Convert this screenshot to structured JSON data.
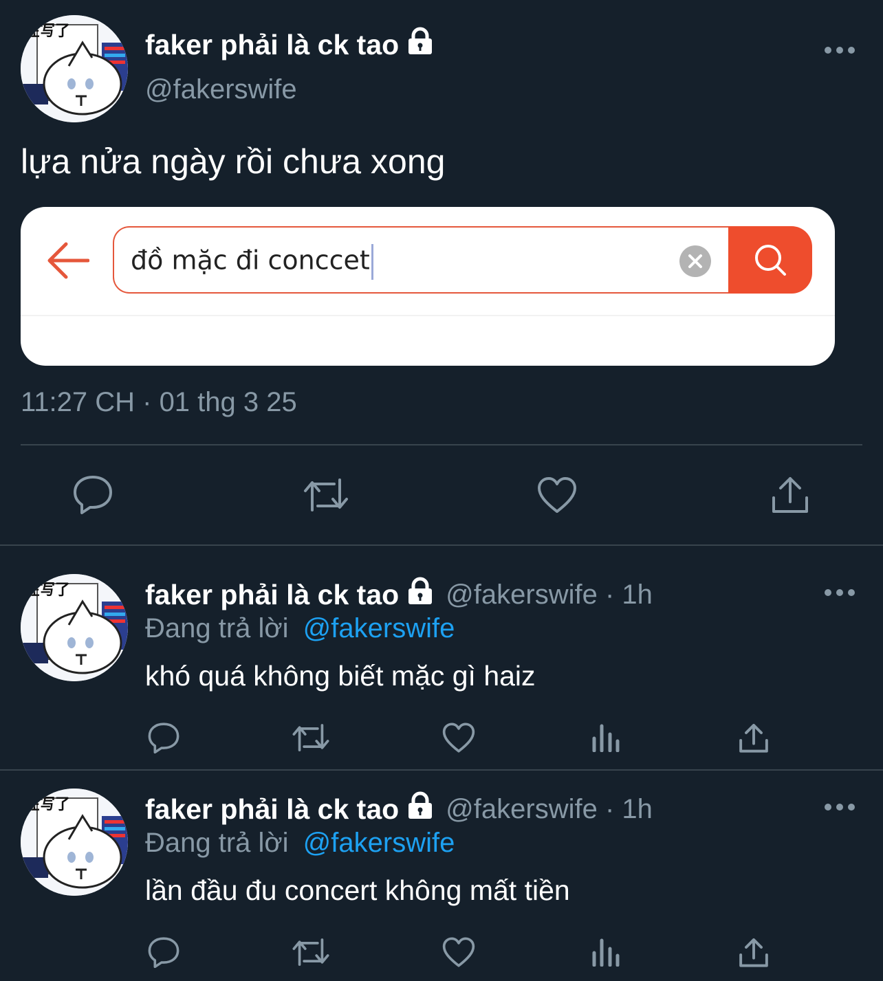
{
  "main_tweet": {
    "display_name": "faker phải là ck tao",
    "handle": "@fakerswife",
    "text": "lựa nửa ngày rồi chưa xong",
    "timestamp": "11:27 CH · 01 thg 3 25",
    "embedded_image": {
      "search_query": "đồ mặc đi conccet"
    }
  },
  "replies": [
    {
      "display_name": "faker phải là ck tao",
      "handle_time": "@fakerswife · 1h",
      "replying_prefix": "Đang trả lời",
      "replying_to": "@fakerswife",
      "text": "khó quá không biết mặc gì haiz"
    },
    {
      "display_name": "faker phải là ck tao",
      "handle_time": "@fakerswife · 1h",
      "replying_prefix": "Đang trả lời",
      "replying_to": "@fakerswife",
      "text": "lần đầu đu concert không mất tiền"
    }
  ],
  "avatar_text": "在写了",
  "colors": {
    "background": "#15202b",
    "muted": "#8899a6",
    "link": "#1da1f2",
    "divider": "#38444d",
    "search_accent": "#ee4d2d"
  },
  "icons": [
    "lock-icon",
    "more-icon",
    "reply-icon",
    "retweet-icon",
    "like-icon",
    "views-icon",
    "share-icon",
    "back-arrow-icon",
    "clear-icon",
    "search-icon"
  ]
}
